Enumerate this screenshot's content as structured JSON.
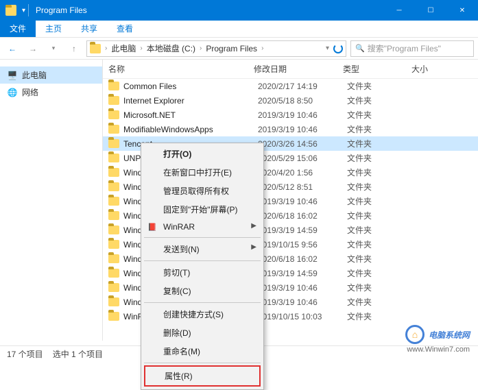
{
  "window": {
    "title": "Program Files"
  },
  "tabs": {
    "file": "文件",
    "home": "主页",
    "share": "共享",
    "view": "查看"
  },
  "breadcrumb": {
    "pc": "此电脑",
    "drive": "本地磁盘 (C:)",
    "folder": "Program Files"
  },
  "search": {
    "placeholder": "搜索\"Program Files\""
  },
  "sidebar": {
    "pc": "此电脑",
    "network": "网络"
  },
  "columns": {
    "name": "名称",
    "date": "修改日期",
    "type": "类型",
    "size": "大小"
  },
  "type_folder": "文件夹",
  "files": [
    {
      "name": "Common Files",
      "date": "2020/2/17 14:19"
    },
    {
      "name": "Internet Explorer",
      "date": "2020/5/18 8:50"
    },
    {
      "name": "Microsoft.NET",
      "date": "2019/3/19 10:46"
    },
    {
      "name": "ModifiableWindowsApps",
      "date": "2019/3/19 10:46"
    },
    {
      "name": "Tencent",
      "date": "2020/3/26 14:56"
    },
    {
      "name": "UNP",
      "date": "2020/5/29 15:06"
    },
    {
      "name": "Windows Defender",
      "date": "2020/4/20 1:56"
    },
    {
      "name": "Windows Defender Advanced",
      "date": "2020/5/12 8:51"
    },
    {
      "name": "Windows Mail",
      "date": "2019/3/19 10:46"
    },
    {
      "name": "Windows Media Player",
      "date": "2020/6/18 16:02"
    },
    {
      "name": "Windows Multimedia Platform",
      "date": "2019/3/19 14:59"
    },
    {
      "name": "Windows NT",
      "date": "2019/10/15 9:56"
    },
    {
      "name": "Windows Photo Viewer",
      "date": "2020/6/18 16:02"
    },
    {
      "name": "Windows Portable Devices",
      "date": "2019/3/19 14:59"
    },
    {
      "name": "Windows Security",
      "date": "2019/3/19 10:46"
    },
    {
      "name": "WindowsPowerShell",
      "date": "2019/3/19 10:46"
    },
    {
      "name": "WinRAR",
      "date": "2019/10/15 10:03"
    }
  ],
  "selected_index": 4,
  "context": {
    "open": "打开(O)",
    "newwindow": "在新窗口中打开(E)",
    "admin": "管理员取得所有权",
    "pin": "固定到\"开始\"屏幕(P)",
    "winrar": "WinRAR",
    "sendto": "发送到(N)",
    "cut": "剪切(T)",
    "copy": "复制(C)",
    "shortcut": "创建快捷方式(S)",
    "delete": "删除(D)",
    "rename": "重命名(M)",
    "properties": "属性(R)"
  },
  "status": {
    "count": "17 个项目",
    "selected": "选中 1 个项目"
  },
  "watermark": {
    "text": "电脑系统网",
    "url": "www.Winwin7.com"
  }
}
